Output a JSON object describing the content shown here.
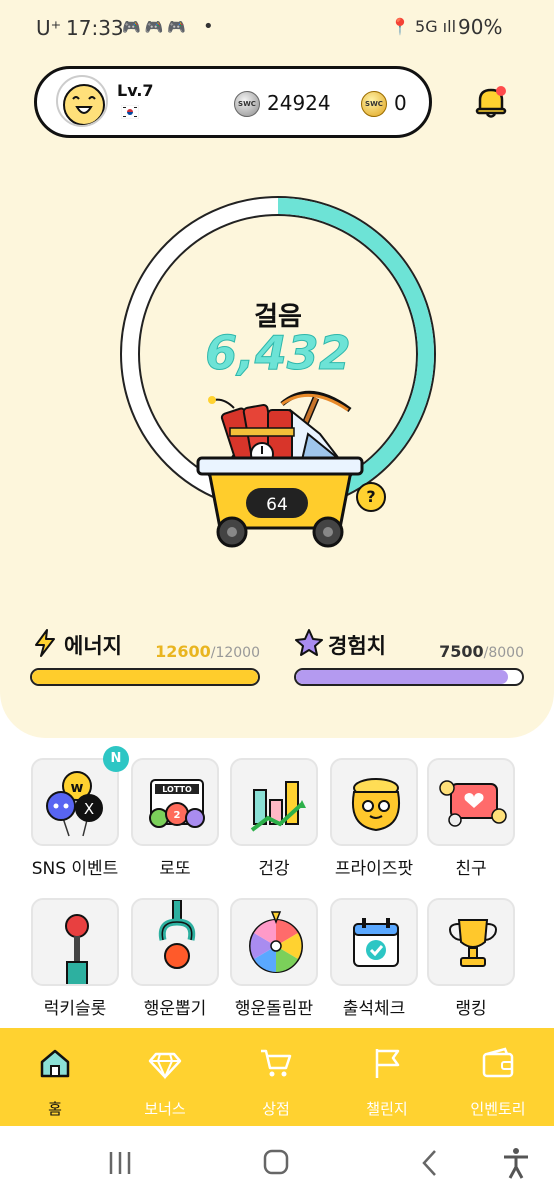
{
  "status_bar": {
    "carrier": "U⁺",
    "time": "17:33",
    "notification_icons": "🎮🎮🎮",
    "dot": "•",
    "network": "📍 5G ıll",
    "battery": "90%"
  },
  "profile": {
    "level": "Lv.7",
    "coins": [
      {
        "icon": "sweatcoin-silver-icon",
        "label": "SWC",
        "value": "24924"
      },
      {
        "icon": "sweatcoin-gold-icon",
        "label": "SWC",
        "value": "0"
      }
    ]
  },
  "steps": {
    "label": "걸음",
    "value": "6,432",
    "progress_fraction": 0.54
  },
  "cart": {
    "count": "64",
    "help": "?"
  },
  "stats": {
    "energy": {
      "label": "에너지",
      "current": "12600",
      "max": "/12000",
      "fill": 1.0,
      "color": "#ffcd2c"
    },
    "exp": {
      "label": "경험치",
      "current": "7500",
      "max": "/8000",
      "fill": 0.9375,
      "color": "#b49af0"
    }
  },
  "menu": {
    "badge_new": "N",
    "items": [
      {
        "label": "SNS 이벤트",
        "icon": "sns-balloons-icon"
      },
      {
        "label": "로또",
        "icon": "lotto-icon"
      },
      {
        "label": "건강",
        "icon": "health-chart-icon"
      },
      {
        "label": "프라이즈팟",
        "icon": "prize-pot-icon"
      },
      {
        "label": "친구",
        "icon": "friends-icon"
      },
      {
        "label": "럭키슬롯",
        "icon": "lucky-slot-icon"
      },
      {
        "label": "행운뽑기",
        "icon": "claw-machine-icon"
      },
      {
        "label": "행운돌림판",
        "icon": "roulette-wheel-icon"
      },
      {
        "label": "출석체크",
        "icon": "calendar-check-icon"
      },
      {
        "label": "랭킹",
        "icon": "trophy-icon"
      }
    ]
  },
  "bottom_nav": {
    "items": [
      {
        "label": "홈",
        "icon": "home-icon",
        "active": true
      },
      {
        "label": "보너스",
        "icon": "diamond-icon",
        "active": false
      },
      {
        "label": "상점",
        "icon": "cart-icon",
        "active": false
      },
      {
        "label": "챌린지",
        "icon": "flag-icon",
        "active": false
      },
      {
        "label": "인벤토리",
        "icon": "wallet-icon",
        "active": false
      }
    ]
  },
  "colors": {
    "accent": "#ffd230",
    "background": "#fdf6dc",
    "steps_teal": "#6de3d6"
  }
}
